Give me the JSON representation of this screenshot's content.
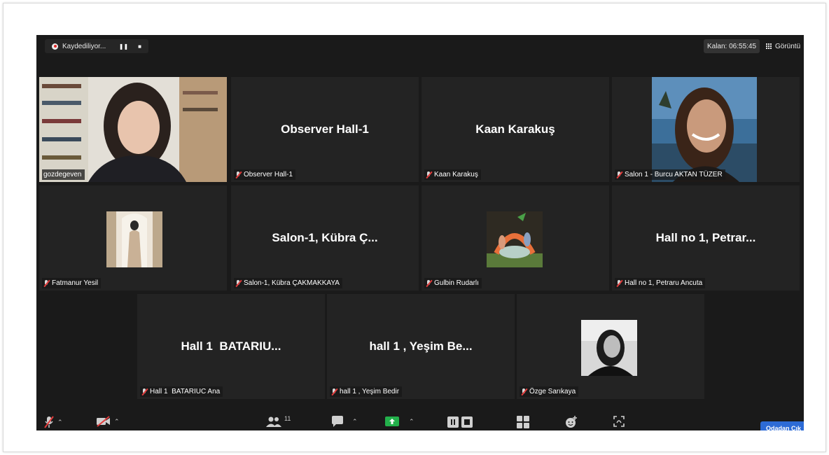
{
  "recording": {
    "label": "Kaydediliyor...",
    "pause": "❚❚",
    "stop": "■"
  },
  "timer": {
    "text": "Kalan: 06:55:45"
  },
  "view": {
    "label": "Görüntü"
  },
  "tiles": [
    {
      "display": "",
      "label": "gozdegeven"
    },
    {
      "display": "Observer Hall-1",
      "label": "Observer Hall-1"
    },
    {
      "display": "Kaan Karakuş",
      "label": "Kaan Karakuş"
    },
    {
      "display": "",
      "label": "Salon 1 - Burcu AKTAN TÜZER"
    },
    {
      "display": "",
      "label": "Fatmanur Yesil"
    },
    {
      "display": "Salon-1, Kübra Ç...",
      "label": "Salon-1, Kübra ÇAKMAKKAYA"
    },
    {
      "display": "",
      "label": "Gulbin Rudarlı"
    },
    {
      "display": "Hall no 1, Petrar...",
      "label": "Hall no 1, Petraru Ancuta"
    },
    {
      "display": "Hall 1  BATARIU...",
      "label": "Hall 1  BATARIUC Ana"
    },
    {
      "display": "hall 1 , Yeşim Be...",
      "label": "hall 1 , Yeşim Bedir"
    },
    {
      "display": "",
      "label": "Özge Sarıkaya"
    }
  ],
  "toolbar": {
    "participants_count": "11",
    "leave_label": "Odadan Çık"
  },
  "colors": {
    "active_speaker_border": "#c6d76c",
    "share_green": "#23b04b",
    "leave_blue": "#2d6bd6",
    "mute_red": "#e23b3b"
  }
}
